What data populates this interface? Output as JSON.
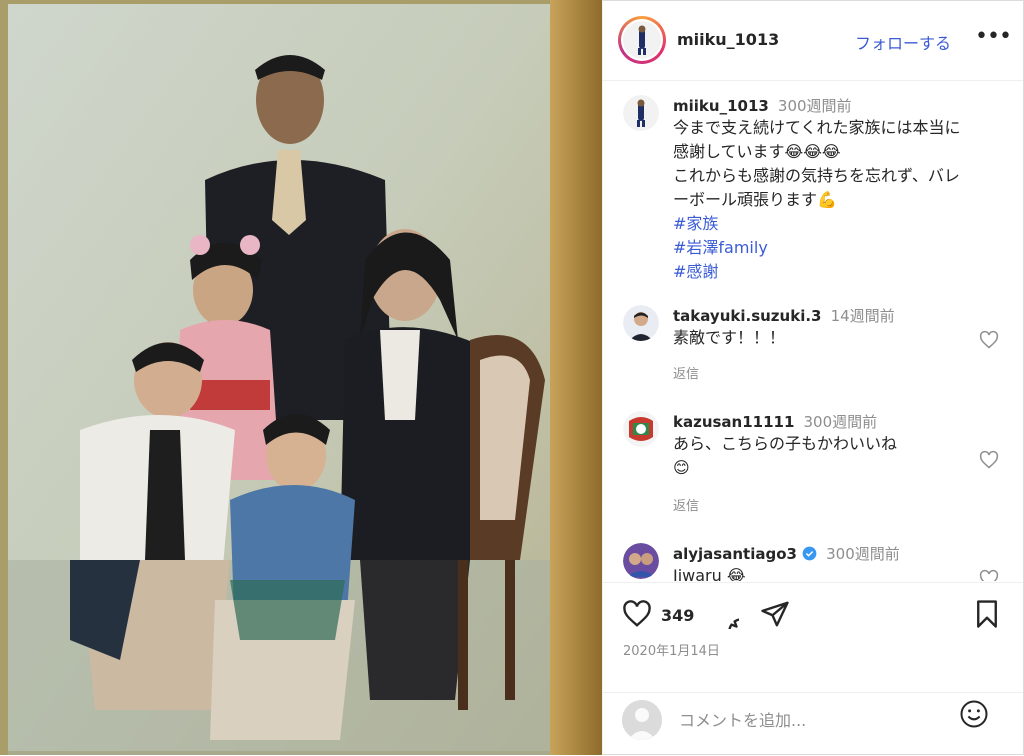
{
  "post": {
    "username": "miiku_1013",
    "follow_label": "フォローする",
    "more_label": "•••"
  },
  "caption": {
    "username": "miiku_1013",
    "time": "300週間前",
    "line1": "今まで支え続けてくれた家族には本当に",
    "line2": "感謝しています😂😂😂",
    "line3": "これからも感謝の気持ちを忘れず、バレ",
    "line4": "ーボール頑張ります💪",
    "tags": [
      "#家族",
      "#岩澤family",
      "#感謝"
    ]
  },
  "comments": [
    {
      "username": "takayuki.suzuki.3",
      "time": "14週間前",
      "text": "素敵です！！！",
      "reply_label": "返信"
    },
    {
      "username": "kazusan11111",
      "time": "300週間前",
      "text": "あら、こちらの子もかわいいね",
      "text2": "😊",
      "reply_label": "返信"
    },
    {
      "username": "alyjasantiago3",
      "time": "300週間前",
      "text": "Jiwaru 😂"
    }
  ],
  "actions": {
    "like_count": "349",
    "date": "2020年1月14日",
    "icons": [
      "heart-icon",
      "comment-icon",
      "share-icon",
      "bookmark-icon"
    ]
  },
  "comment_input": {
    "placeholder": "コメントを追加..."
  },
  "colors": {
    "link": "#3b5bd6",
    "muted": "#8e8e8e",
    "verified": "#3897f0"
  }
}
